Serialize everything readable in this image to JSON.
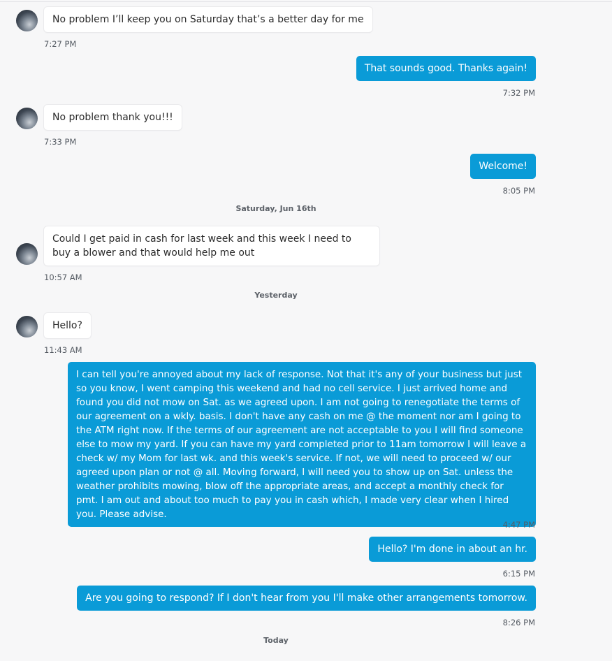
{
  "messages": [
    {
      "direction": "in",
      "text": "No problem I’ll keep you on Saturday that’s a better day for me",
      "time": "7:27 PM"
    },
    {
      "direction": "out",
      "text": "That sounds good. Thanks again!",
      "time": "7:32 PM"
    },
    {
      "direction": "in",
      "text": "No problem thank you!!!",
      "time": "7:33 PM"
    },
    {
      "direction": "out",
      "text": "Welcome!",
      "time": "8:05 PM"
    },
    {
      "direction": "in",
      "text": "Could I get paid in cash for last week and this week I need to buy a blower and that would help me out",
      "time": "10:57 AM"
    },
    {
      "direction": "in",
      "text": "Hello?",
      "time": "11:43 AM"
    },
    {
      "direction": "out",
      "text": "I can tell you're annoyed about my lack of response. Not that it's any of your business but just so you know, I went camping this weekend and had no cell service. I just arrived home and found you did not mow on Sat. as we agreed upon. I am not going to renegotiate the terms of our agreement on a wkly. basis. I don't have any cash on me @ the moment nor am I going to the ATM right now. If the terms of our agreement are not acceptable to you I will find someone else to mow my yard. If you can have my yard completed prior to 11am tomorrow I will leave a check w/ my Mom for last wk. and this week's service. If not, we will need to proceed w/ our agreed upon plan or not @ all. Moving forward, I will need you to show up on Sat. unless the weather prohibits mowing, blow off the appropriate areas, and accept a monthly check for pmt. I am out and about too much to pay you in cash which, I made very clear when I hired you. Please advise.",
      "time": "4:47 PM"
    },
    {
      "direction": "out",
      "text": "Hello? I'm done in about an hr.",
      "time": "6:15 PM"
    },
    {
      "direction": "out",
      "text": "Are you going to respond? If I don't hear from you I'll make other arrangements tomorrow.",
      "time": "8:26 PM"
    }
  ],
  "dividers": [
    "Saturday, Jun 16th",
    "Yesterday",
    "Today"
  ]
}
